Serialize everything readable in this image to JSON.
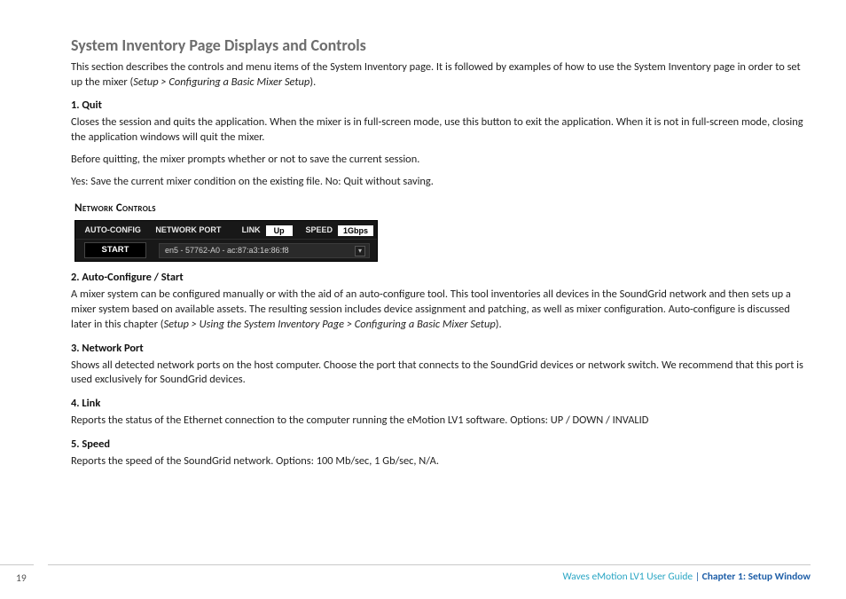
{
  "title": "System Inventory Page Displays and Controls",
  "intro": "This section describes the controls and menu items of the System Inventory page. It is followed by examples of how to use the System Inventory page in order to set up the mixer (",
  "intro_ital": "Setup > Configuring a Basic Mixer Setup",
  "intro_close": ").",
  "s1_head": "1. Quit",
  "s1_p1": "Closes the session and quits the application. When the mixer is in full-screen mode, use this button to exit the application. When it is not in full-screen mode, closing the application windows will quit the mixer.",
  "s1_p2": "Before quitting, the mixer prompts whether or not to save the current session.",
  "s1_p3": "Yes: Save the current mixer condition on the existing file. No: Quit without saving.",
  "net_head": "Network Controls",
  "panel": {
    "auto": "AUTO-CONFIG",
    "port": "NETWORK PORT",
    "link": "LINK",
    "link_val": "Up",
    "speed": "SPEED",
    "speed_val": "1Gbps",
    "start": "START",
    "port_val": "en5 - 57762-A0 - ac:87:a3:1e:86:f8"
  },
  "s2_head": "2. Auto-Configure / Start",
  "s2_p1": "A mixer system can be configured manually or with the aid of an auto-configure tool. This tool inventories all devices in the SoundGrid network and then sets up a mixer system based on available assets. The resulting session includes device assignment and patching, as well as mixer configuration. Auto-configure is discussed later in this chapter (",
  "s2_ital": "Setup > Using the System Inventory Page > Configuring a Basic Mixer Setup",
  "s2_close": ").",
  "s3_head": "3. Network Port",
  "s3_p1": "Shows all detected network ports on the host computer. Choose the port that connects to the SoundGrid devices or network switch. We recommend that this port is used exclusively for SoundGrid devices.",
  "s4_head": "4. Link",
  "s4_p1": "Reports the status of the Ethernet connection to the computer running the eMotion LV1 software. Options: UP / DOWN / INVALID",
  "s5_head": "5. Speed",
  "s5_p1": "Reports the speed of the SoundGrid network. Options: 100 Mb/sec, 1 Gb/sec, N/A.",
  "footer": {
    "page": "19",
    "brand": "Waves eMotion LV1 User Guide",
    "sep": " | ",
    "chapter": "Chapter 1: Setup Window"
  }
}
